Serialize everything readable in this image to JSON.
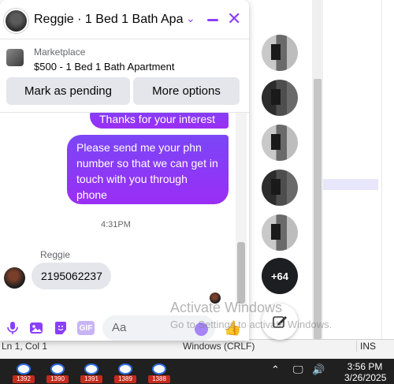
{
  "chat": {
    "title": "Reggie · 1 Bed 1 Bath Apar...",
    "chevron": "⌄",
    "close": "✕",
    "marketplace_label": "Marketplace",
    "listing": "$500 - 1 Bed 1 Bath Apartment",
    "btn_pending": "Mark as pending",
    "btn_more": "More options",
    "messages": [
      {
        "from": "me",
        "text": "Thanks for your interest"
      },
      {
        "from": "me",
        "text": "Please send me your phn number so that we can get in touch with you through phone"
      },
      {
        "from": "them",
        "sender": "Reggie",
        "text": "2195062237"
      }
    ],
    "timestamp": "4:31PM",
    "input_placeholder": "Aa",
    "gif_label": "GIF"
  },
  "side": {
    "more_count": "+64",
    "compose_icon": "edit-icon"
  },
  "watermark": {
    "line1": "Activate Windows",
    "line2": "Go to Settings to activate Windows."
  },
  "background_status": {
    "left": "Ln 1, Col 1",
    "mid": "Windows (CRLF)",
    "ins": "INS"
  },
  "taskbar": {
    "badges": [
      "1392",
      "1390",
      "1391",
      "1389",
      "1388"
    ],
    "time": "3:56 PM",
    "date": "3/26/2025"
  }
}
